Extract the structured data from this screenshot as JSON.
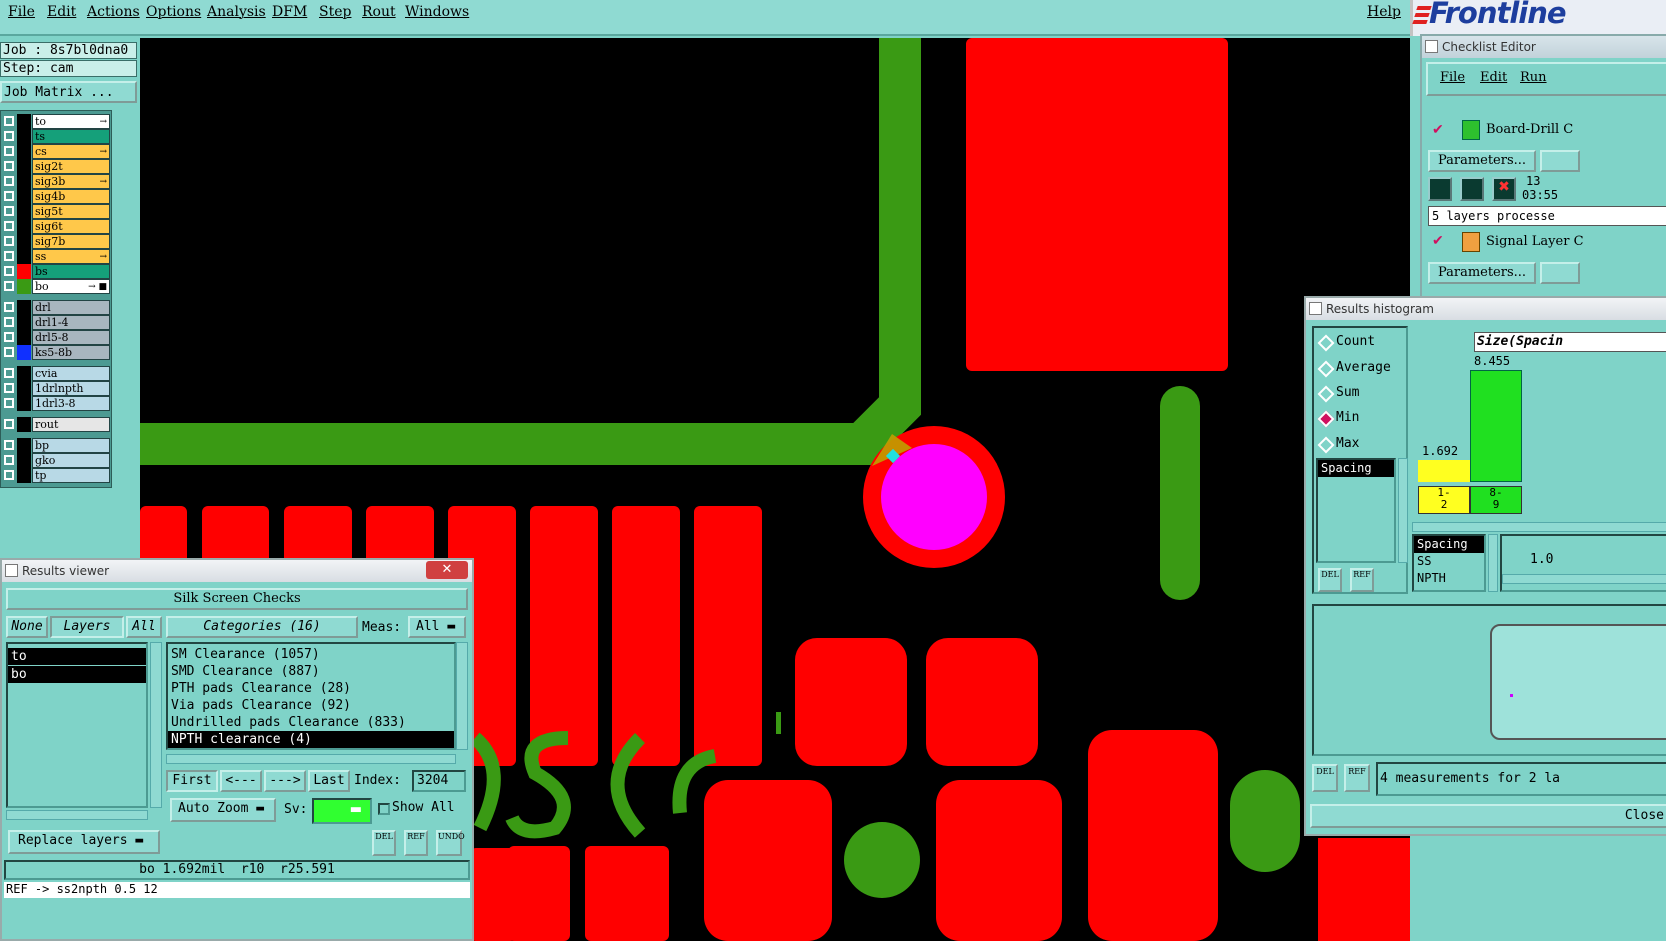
{
  "menubar": {
    "items": [
      "File",
      "Edit",
      "Actions",
      "Options",
      "Analysis",
      "DFM",
      "Step",
      "Rout",
      "Windows"
    ],
    "help": "Help",
    "logo": "Frontline"
  },
  "left_panel": {
    "job": "Job : 8s7bl0dna0",
    "step": "Step: cam",
    "job_matrix": "Job Matrix ...",
    "layers": [
      {
        "name": "to",
        "color": "#ffffff",
        "swatch": "#000000",
        "mark": "→"
      },
      {
        "name": "ts",
        "color": "#15a07a",
        "swatch": "#000000",
        "mark": ""
      },
      {
        "name": "cs",
        "color": "#ffc84a",
        "swatch": "#000000",
        "mark": "→"
      },
      {
        "name": "sig2t",
        "color": "#ffc84a",
        "swatch": "#000000",
        "mark": ""
      },
      {
        "name": "sig3b",
        "color": "#ffc84a",
        "swatch": "#000000",
        "mark": "→"
      },
      {
        "name": "sig4b",
        "color": "#ffc84a",
        "swatch": "#000000",
        "mark": ""
      },
      {
        "name": "sig5t",
        "color": "#ffc84a",
        "swatch": "#000000",
        "mark": ""
      },
      {
        "name": "sig6t",
        "color": "#ffc84a",
        "swatch": "#000000",
        "mark": ""
      },
      {
        "name": "sig7b",
        "color": "#ffc84a",
        "swatch": "#000000",
        "mark": ""
      },
      {
        "name": "ss",
        "color": "#ffc84a",
        "swatch": "#000000",
        "mark": "→"
      },
      {
        "name": "bs",
        "color": "#15a07a",
        "swatch": "#ff0000",
        "mark": ""
      },
      {
        "name": "bo",
        "color": "#ffffff",
        "swatch": "#3a9a14",
        "mark": "→ ■"
      },
      {
        "name": "drl",
        "color": "#a8b6bf",
        "swatch": "#000000",
        "mark": ""
      },
      {
        "name": "drl1-4",
        "color": "#a8b6bf",
        "swatch": "#000000",
        "mark": ""
      },
      {
        "name": "drl5-8",
        "color": "#a8b6bf",
        "swatch": "#000000",
        "mark": ""
      },
      {
        "name": "ks5-8b",
        "color": "#a8b6bf",
        "swatch": "#1030ff",
        "mark": ""
      },
      {
        "name": "cvia",
        "color": "#b8d9e6",
        "swatch": "#000000",
        "mark": ""
      },
      {
        "name": "1drlnpth",
        "color": "#b8d9e6",
        "swatch": "#000000",
        "mark": ""
      },
      {
        "name": "1drl3-8",
        "color": "#b8d9e6",
        "swatch": "#000000",
        "mark": ""
      },
      {
        "name": "rout",
        "color": "#e6e6e6",
        "swatch": "#000000",
        "mark": ""
      },
      {
        "name": "bp",
        "color": "#b8d9e6",
        "swatch": "#000000",
        "mark": ""
      },
      {
        "name": "gko",
        "color": "#b8d9e6",
        "swatch": "#000000",
        "mark": ""
      },
      {
        "name": "tp",
        "color": "#b8d9e6",
        "swatch": "#000000",
        "mark": ""
      }
    ]
  },
  "results_viewer": {
    "title": "Results viewer",
    "header": "Silk Screen Checks",
    "tabs": {
      "none": "None",
      "layers": "Layers",
      "all": "All"
    },
    "categories_label": "Categories (16)",
    "meas_label": "Meas:",
    "meas_value": "All",
    "layer_list": [
      "to",
      "bo"
    ],
    "categories": [
      "SM Clearance (1057)",
      "SMD Clearance (887)",
      "PTH pads Clearance (28)",
      "Via pads Clearance (92)",
      "Undrilled pads Clearance (833)",
      "NPTH clearance (4)"
    ],
    "nav": {
      "first": "First",
      "prev": "<---",
      "next": "--->",
      "last": "Last",
      "index_label": "Index:",
      "index_value": "3204"
    },
    "auto_zoom": "Auto Zoom",
    "sv_label": "Sv:",
    "show_all": "Show All",
    "replace_layers": "Replace layers",
    "icon_labels": [
      "DEL",
      "REF",
      "UNDO"
    ],
    "status": "bo 1.692mil  r10  r25.591",
    "command": "REF -> ss2npth  0.5 12"
  },
  "checklist": {
    "title": "Checklist Editor",
    "menu": [
      "File",
      "Edit",
      "Run"
    ],
    "items": [
      {
        "name": "Board-Drill C",
        "params": "Parameters...",
        "time_top": "13",
        "time": "03:55",
        "status": "5 layers processe"
      },
      {
        "name": "Signal Layer C",
        "params": "Parameters..."
      }
    ]
  },
  "histogram": {
    "title": "Results histogram",
    "options": [
      "Count",
      "Average",
      "Sum",
      "Min",
      "Max"
    ],
    "selected": "Min",
    "list": [
      "Spacing"
    ],
    "size_label": "Size(Spacin",
    "bins": [
      {
        "label": "1-\n2",
        "value": 1.692
      },
      {
        "label": "8-\n9",
        "value": 8.455
      }
    ],
    "value_labels": [
      "1.692",
      "8.455"
    ],
    "sub_list": [
      "Spacing",
      "SS",
      "NPTH"
    ],
    "slider_value": "1.0",
    "icons": [
      "DEL",
      "REF"
    ],
    "measurements": "4 measurements for 2 la",
    "close": "Close"
  }
}
